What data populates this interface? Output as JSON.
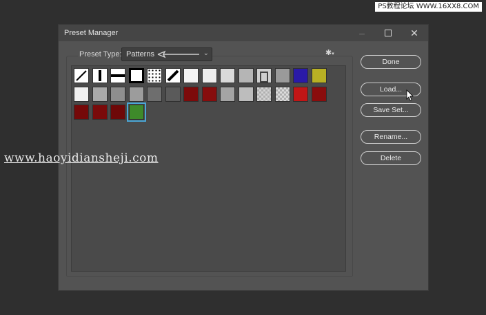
{
  "watermark_top": "PS教程论坛 WWW.16XX8.COM",
  "watermark_mid": "www.haoyidiansheji.com",
  "dialog": {
    "title": "Preset Manager",
    "minimize_icon": "minimize-icon",
    "maximize_icon": "maximize-icon",
    "close_icon": "close-icon",
    "close_glyph": "✕",
    "preset_type_label": "Preset Type:",
    "preset_type_value": "Patterns",
    "preset_type_arrow": "⌄",
    "gear_glyph": "✱",
    "gear_caret": "▾"
  },
  "buttons": {
    "done": "Done",
    "load": "Load...",
    "save_set": "Save Set...",
    "rename": "Rename...",
    "delete": "Delete"
  },
  "patterns": [
    {
      "name": "diagonal-line",
      "fill": "#ffffff"
    },
    {
      "name": "vertical-bar",
      "fill": "#ffffff"
    },
    {
      "name": "horizontal-bar",
      "fill": "#ffffff"
    },
    {
      "name": "black-frame",
      "fill": "#ffffff"
    },
    {
      "name": "dots",
      "fill": "#ffffff"
    },
    {
      "name": "diagonal-bold",
      "fill": "#ffffff"
    },
    {
      "name": "white-1",
      "fill": "#f4f4f4"
    },
    {
      "name": "white-2",
      "fill": "#eeeeee"
    },
    {
      "name": "light-gray",
      "fill": "#d9d9d9"
    },
    {
      "name": "gray-noise",
      "fill": "#b5b5b5"
    },
    {
      "name": "square-frame",
      "fill": "#cfcfcf"
    },
    {
      "name": "crumple",
      "fill": "#9a9a9a"
    },
    {
      "name": "blue-texture",
      "fill": "#2a1aa8"
    },
    {
      "name": "yellow-texture",
      "fill": "#b8b024"
    },
    {
      "name": "white-3",
      "fill": "#f0f0f0"
    },
    {
      "name": "gray-1",
      "fill": "#a9a9a9"
    },
    {
      "name": "gray-grid",
      "fill": "#8e8e8e"
    },
    {
      "name": "gray-2",
      "fill": "#9c9c9c"
    },
    {
      "name": "dark-gray-1",
      "fill": "#6e6e6e"
    },
    {
      "name": "dark-gray-2",
      "fill": "#5a5a5a"
    },
    {
      "name": "red-1",
      "fill": "#7c0b0b"
    },
    {
      "name": "red-2",
      "fill": "#860d0d"
    },
    {
      "name": "gray-3",
      "fill": "#a4a4a4"
    },
    {
      "name": "gray-noise-2",
      "fill": "#bdbdbd"
    },
    {
      "name": "checker-1",
      "fill": "#d4d4d4"
    },
    {
      "name": "checker-2",
      "fill": "#dcdcdc"
    },
    {
      "name": "red-bright",
      "fill": "#c11616"
    },
    {
      "name": "red-3",
      "fill": "#8a0d0d"
    },
    {
      "name": "red-4",
      "fill": "#750909"
    },
    {
      "name": "red-5",
      "fill": "#7a0a0a"
    },
    {
      "name": "red-6",
      "fill": "#6e0808"
    },
    {
      "name": "green-texture",
      "fill": "#3e8a2a"
    }
  ]
}
